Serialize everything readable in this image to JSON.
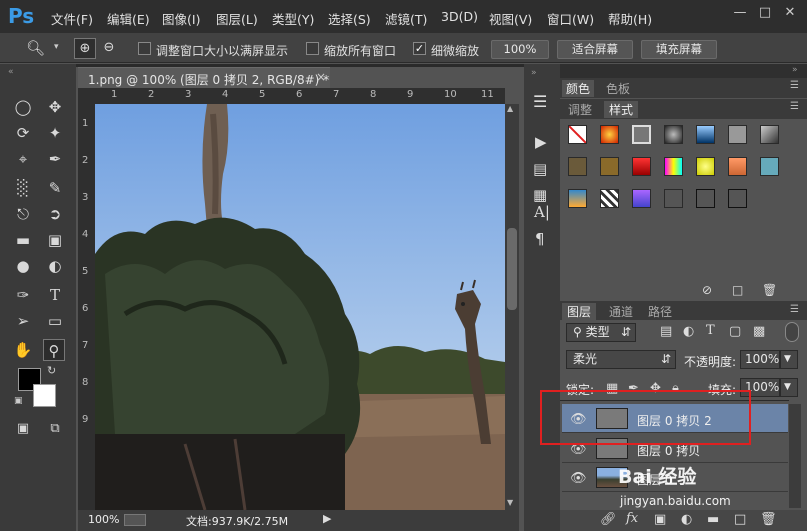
{
  "app": {
    "logo": "Ps"
  },
  "menu": [
    "文件(F)",
    "编辑(E)",
    "图像(I)",
    "图层(L)",
    "类型(Y)",
    "选择(S)",
    "滤镜(T)",
    "3D(D)",
    "视图(V)",
    "窗口(W)",
    "帮助(H)"
  ],
  "options": {
    "resize_windows": "调整窗口大小以满屏显示",
    "zoom_all": "缩放所有窗口",
    "scrubby": "细微缩放",
    "zoom_btn": "100%",
    "fit_screen": "适合屏幕",
    "fill_screen": "填充屏幕"
  },
  "document": {
    "tab_title": "1.png @ 100% (图层 0 拷贝 2, RGB/8#) *",
    "close": "×",
    "ruler_top": [
      "1",
      "2",
      "3",
      "4",
      "5",
      "6",
      "7",
      "8",
      "9",
      "10",
      "11"
    ],
    "ruler_left": [
      "1",
      "2",
      "3",
      "4",
      "5",
      "6",
      "7",
      "8",
      "9"
    ],
    "zoom": "100%",
    "doc_size": "文档:937.9K/2.75M"
  },
  "panels": {
    "color_tabs": [
      "颜色",
      "色板"
    ],
    "adjust_tabs": [
      "调整",
      "样式"
    ],
    "layers_tabs": [
      "图层",
      "通道",
      "路径"
    ],
    "filter_kind": "类型",
    "blend_mode": "柔光",
    "opacity_label": "不透明度:",
    "opacity_value": "100%",
    "lock_label": "锁定:",
    "fill_label": "填充:",
    "fill_value": "100%"
  },
  "layers": [
    {
      "name": "图层 0 拷贝 2",
      "selected": true
    },
    {
      "name": "图层 0 拷贝",
      "selected": false
    },
    {
      "name": "图层 0",
      "selected": false
    }
  ],
  "watermark": {
    "brand": "Bai 经验",
    "url": "jingyan.baidu.com"
  },
  "colors": {
    "accent": "#3b9be6",
    "selected_layer": "#6b84a8",
    "highlight": "#e02020"
  }
}
